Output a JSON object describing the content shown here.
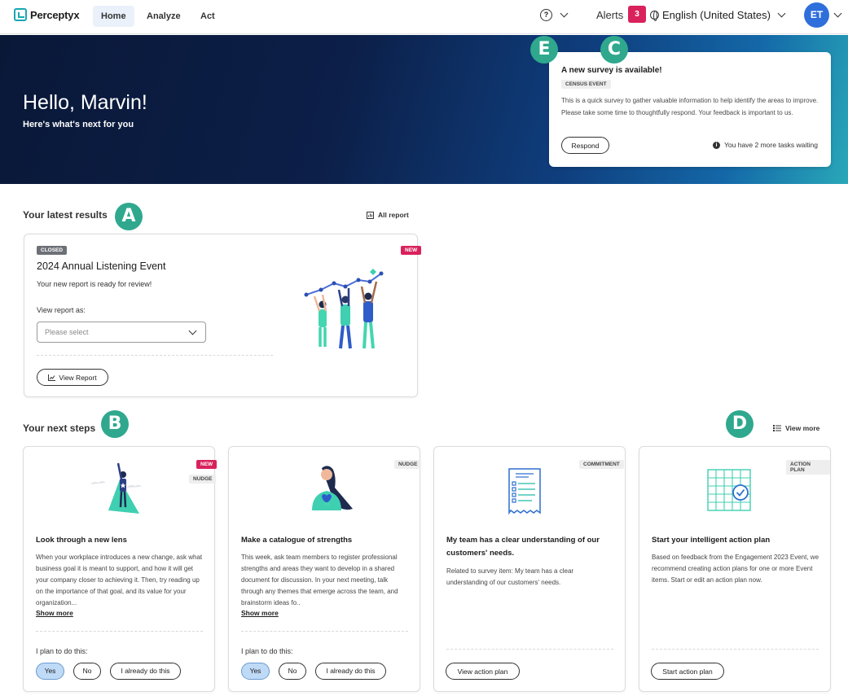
{
  "nav": {
    "brand": "Perceptyx",
    "tabs": [
      {
        "label": "Home",
        "active": true
      },
      {
        "label": "Analyze",
        "active": false
      },
      {
        "label": "Act",
        "active": false
      }
    ],
    "help_glyph": "?",
    "alerts_label": "Alerts",
    "alerts_count": "3",
    "language": "English (United States)",
    "user_initials": "ET"
  },
  "hero": {
    "title": "Hello, Marvin!",
    "subtitle": "Here's what's next for you"
  },
  "survey": {
    "title": "A new survey is available!",
    "tag": "CENSUS EVENT",
    "body": "This is a quick survey to gather valuable information to help identify the areas to improve. Please take some time to thoughtfully respond. Your feedback is important to us.",
    "respond_label": "Respond",
    "info_glyph": "i",
    "tasks_text": "You have 2 more tasks waiting"
  },
  "markers": {
    "a": "A",
    "b": "B",
    "c": "C",
    "d": "D",
    "e": "E"
  },
  "results": {
    "section_title": "Your latest results",
    "all_report_label": "All report",
    "closed_tag": "CLOSED",
    "new_tag": "NEW",
    "title": "2024 Annual Listening Event",
    "message": "Your new report is ready for review!",
    "view_as_label": "View report as:",
    "select_placeholder": "Please select",
    "view_report_label": "View Report"
  },
  "next_steps": {
    "section_title": "Your next steps",
    "view_more_label": "View more",
    "plan_label": "I plan to do this:",
    "show_more_label": "Show more",
    "cards": [
      {
        "new_tag": "NEW",
        "type_tag": "NUDGE",
        "title": "Look through a new lens",
        "body": "When your workplace introduces a new change, ask what business goal it is meant to support, and how it will get your company closer to achieving it. Then, try reading up on the importance of that goal, and its value for your organization...",
        "options": [
          "Yes",
          "No",
          "I already do this"
        ],
        "selected": "Yes"
      },
      {
        "type_tag": "NUDGE",
        "title": "Make a catalogue of strengths",
        "body": "This week, ask team members to register professional strengths and areas they want to develop in a shared document for discussion. In your next meeting, talk through any themes that emerge across the team, and brainstorm ideas fo..",
        "options": [
          "Yes",
          "No",
          "I already do this"
        ],
        "selected": "Yes"
      },
      {
        "type_tag": "COMMITMENT",
        "title": "My team has a clear understanding of our customers' needs.",
        "body": "Related to survey item: My team has a clear understanding of our customers' needs.",
        "button_label": "View action plan"
      },
      {
        "type_tag": "ACTION PLAN",
        "title": "Start your intelligent action plan",
        "body": "Based on feedback from the Engagement 2023 Event, we recommend creating action plans for one or more Event items. Start or edit an action plan now.",
        "button_label": "Start action plan"
      }
    ]
  },
  "colors": {
    "accent": "#1ba7b2",
    "alert_badge": "#d9225b",
    "avatar": "#2f6fdc",
    "marker": "#2fa88e",
    "selected_pill": "#bfdaf6"
  }
}
